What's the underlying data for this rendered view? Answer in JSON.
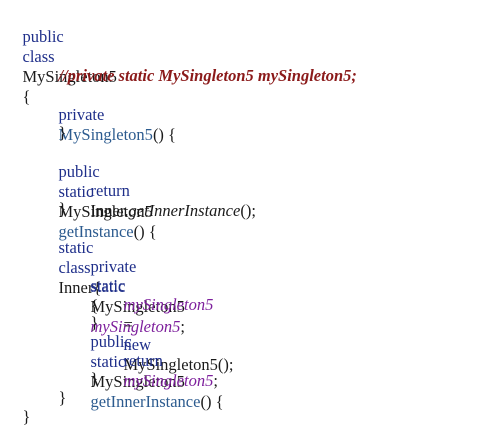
{
  "code": {
    "line1": {
      "kw_public": "public",
      "kw_class": "class",
      "class_name": "MySingleton5",
      "brace": "{"
    },
    "line2": {
      "comment": "//private static MySingleton5 mySingleton5;"
    },
    "line3": {
      "kw_private": "private",
      "ctor_name": "MySingleton5",
      "rest": "() {"
    },
    "line4": {
      "brace": "}"
    },
    "line5": {
      "kw_public": "public",
      "kw_static": "static",
      "type": "MySingleton5",
      "method": "getInstance",
      "rest": "() {"
    },
    "line6": {
      "kw_return": "return",
      "target": "Inner.",
      "call": "getInnerInstance",
      "rest": "();"
    },
    "line7": {
      "brace": "}"
    },
    "line8": {
      "kw_static": "static",
      "kw_class": "class",
      "inner_name": "Inner{"
    },
    "line9": {
      "kw_private": "private",
      "kw_static": "static",
      "type": "MySingleton5",
      "field": "mySingleton5",
      "rest": ";"
    },
    "line10": {
      "kw_static": "static",
      "brace": "{"
    },
    "line11": {
      "field": "mySingleton5",
      "eq": "=",
      "kw_new": "new",
      "rest": "MySingleton5();"
    },
    "line12": {
      "brace": "}"
    },
    "line13": {
      "kw_public": "public",
      "kw_static": "static",
      "type": "MySingleton5",
      "method": "getInnerInstance",
      "rest": "() {"
    },
    "line14": {
      "kw_return": "return",
      "field": "mySingleton5",
      "rest": ";"
    },
    "line15": {
      "brace": "}"
    },
    "line16": {
      "brace": "}"
    },
    "line17": {
      "brace": "}"
    }
  },
  "colors": {
    "keyword": "#1f2f8a",
    "method": "#2c5b8f",
    "field": "#7d1f9c",
    "comment": "#8b1a1a",
    "text": "#1a1a1a"
  }
}
